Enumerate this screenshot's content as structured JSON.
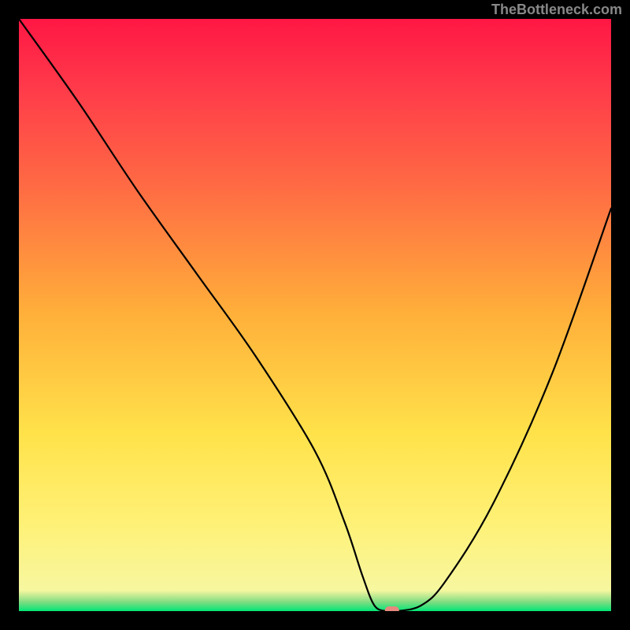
{
  "watermark": "TheBottleneck.com",
  "chart_data": {
    "type": "line",
    "title": "",
    "xlabel": "",
    "ylabel": "",
    "xlim": [
      0,
      100
    ],
    "ylim": [
      0,
      100
    ],
    "curve": {
      "name": "bottleneck-curve",
      "x": [
        0,
        10,
        20,
        30,
        40,
        50,
        55,
        58,
        60,
        62,
        64,
        68,
        72,
        80,
        90,
        100
      ],
      "y": [
        100,
        86,
        71,
        57,
        43,
        27,
        15,
        6,
        1,
        0,
        0,
        1,
        5,
        18,
        40,
        68
      ]
    },
    "marker": {
      "x": 63,
      "y": 0,
      "color": "#e8887f"
    },
    "gradient_background": {
      "desc": "vertical gradient red-orange-yellow-green, then thin green band at bottom",
      "stops": [
        {
          "pos": 0.0,
          "color": "#ff1744"
        },
        {
          "pos": 0.12,
          "color": "#ff3b4a"
        },
        {
          "pos": 0.3,
          "color": "#ff7043"
        },
        {
          "pos": 0.5,
          "color": "#ffb03a"
        },
        {
          "pos": 0.7,
          "color": "#ffe24a"
        },
        {
          "pos": 0.85,
          "color": "#fff176"
        },
        {
          "pos": 0.965,
          "color": "#f7f7a0"
        },
        {
          "pos": 0.985,
          "color": "#7ddc82"
        },
        {
          "pos": 1.0,
          "color": "#00e676"
        }
      ]
    }
  }
}
